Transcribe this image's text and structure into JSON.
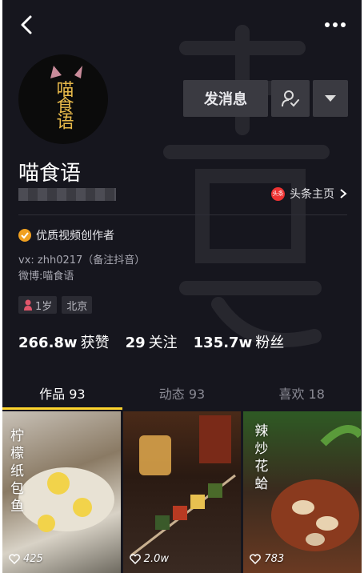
{
  "header": {
    "back_icon": "chevron-left-icon",
    "more_icon": "ellipsis-icon"
  },
  "avatar": {
    "logo_text": "喵食语"
  },
  "actions": {
    "message_label": "发消息",
    "follow_icon": "user-check-icon",
    "dropdown_icon": "triangle-down-icon"
  },
  "profile": {
    "name": "喵食语",
    "toutiao_badge": "头条",
    "toutiao_label": "头条主页"
  },
  "verified": {
    "label": "优质视频创作者"
  },
  "bio": {
    "line1": "vx: zhh0217（备注抖音）",
    "line2": "微博:喵食语"
  },
  "tags": [
    {
      "label": "1岁",
      "icon": "female-icon"
    },
    {
      "label": "北京"
    }
  ],
  "stats": [
    {
      "value": "266.8w",
      "label": "获赞"
    },
    {
      "value": "29",
      "label": "关注"
    },
    {
      "value": "135.7w",
      "label": "粉丝"
    }
  ],
  "tabs": [
    {
      "label": "作品 93",
      "active": true
    },
    {
      "label": "动态 93",
      "active": false
    },
    {
      "label": "喜欢 18",
      "active": false
    }
  ],
  "videos": [
    {
      "likes": "425",
      "caption": "柠檬纸包鱼"
    },
    {
      "likes": "2.0w",
      "caption": ""
    },
    {
      "likes": "783",
      "caption": "辣炒花蛤"
    }
  ],
  "colors": {
    "background": "#16161e",
    "button": "#3a3a41",
    "tab_indicator": "#ffd52e",
    "verified": "#f0a020"
  }
}
